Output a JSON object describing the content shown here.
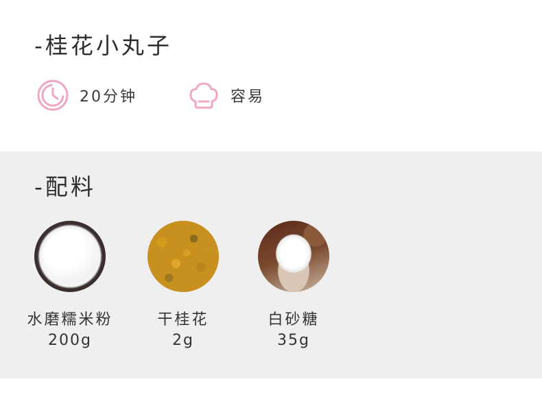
{
  "recipe": {
    "title": "-桂花小丸子",
    "time": "20分钟",
    "difficulty": "容易"
  },
  "icons": {
    "clock": "clock-icon",
    "difficulty": "chef-hat-icon",
    "accent_color": "#f0a8c2"
  },
  "ingredients": {
    "title": "-配料",
    "items": [
      {
        "name": "水磨糯米粉",
        "amount": "200g",
        "photo": "rice-flour-photo"
      },
      {
        "name": "干桂花",
        "amount": "2g",
        "photo": "dried-osmanthus-photo"
      },
      {
        "name": "白砂糖",
        "amount": "35g",
        "photo": "white-sugar-photo"
      }
    ]
  }
}
